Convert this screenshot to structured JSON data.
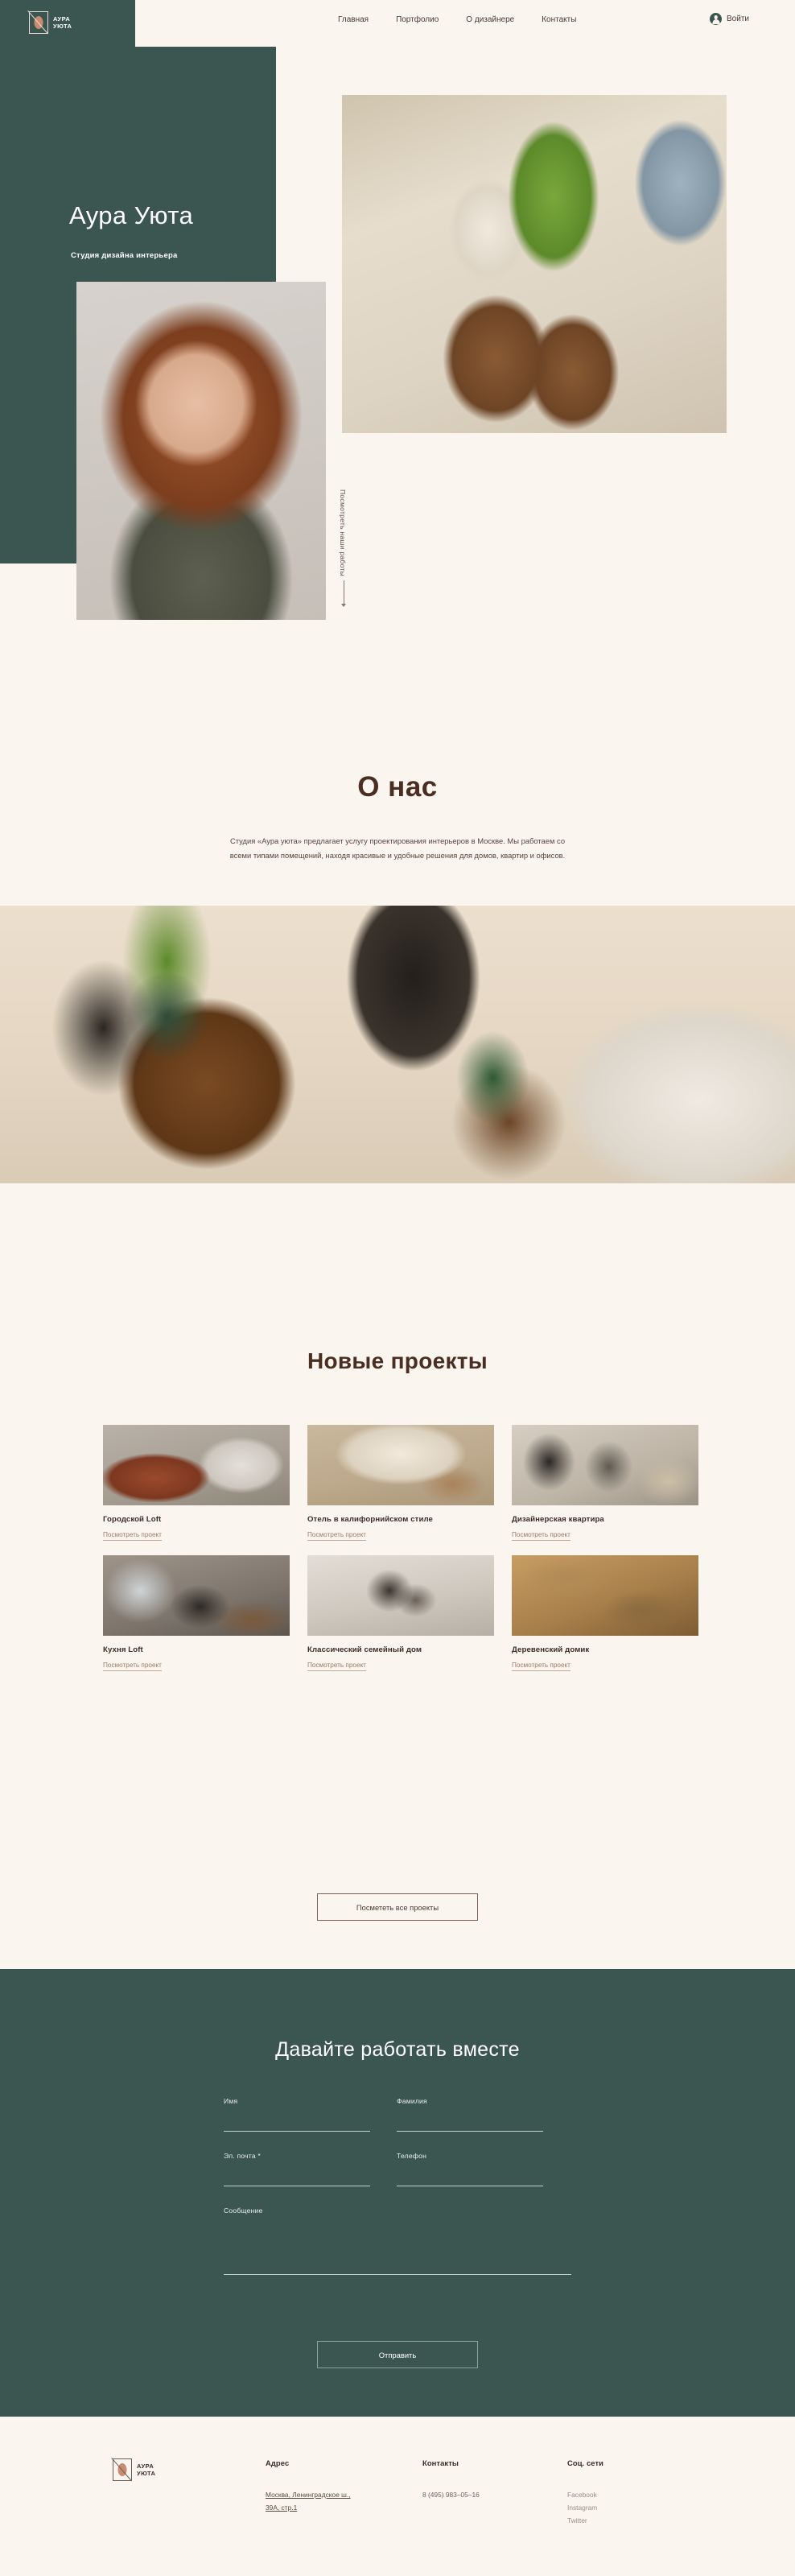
{
  "brand": {
    "line1": "АУРА",
    "line2": "УЮТА"
  },
  "header": {
    "nav": [
      {
        "label": "Главная"
      },
      {
        "label": "Портфолио"
      },
      {
        "label": "О дизайнере"
      },
      {
        "label": "Контакты"
      }
    ],
    "login_label": "Войти",
    "avatar_icon": "user-circle-icon"
  },
  "hero": {
    "title": "Аура Уюта",
    "subtitle": "Студия дизайна интерьера",
    "vertical_cta": "Посмотреть наши работы",
    "portrait_alt": "designer-portrait",
    "main_image_alt": "living-room-interior"
  },
  "about": {
    "heading": "О нас",
    "paragraph": "Студия «Аура уюта» предлагает услугу проектирования интерьеров в Москве. Мы работаем со всеми типами помещений, находя красивые и удобные решения для домов, квартир и офисов."
  },
  "band": {
    "alt": "interior-dresser-band-image"
  },
  "projects": {
    "heading": "Новые проекты",
    "link_label": "Посмотреть проект",
    "items": [
      {
        "title": "Городской Loft",
        "link": "Посмотреть проект"
      },
      {
        "title": "Отель в калифорнийском стиле",
        "link": "Посмотреть проект"
      },
      {
        "title": "Дизайнерская квартира",
        "link": "Посмотреть проект"
      },
      {
        "title": "Кухня Loft",
        "link": "Посмотреть проект"
      },
      {
        "title": "Классический семейный дом",
        "link": "Посмотреть проект"
      },
      {
        "title": "Деревенский домик",
        "link": "Посмотреть проект"
      }
    ],
    "all_button": "Посмететь все проекты"
  },
  "contact": {
    "heading": "Давайте работать вместе",
    "fields": {
      "first_name": "Имя",
      "last_name": "Фамилия",
      "email": "Эл. почта *",
      "phone": "Телефон",
      "message": "Сообщение"
    },
    "submit": "Отправить"
  },
  "footer": {
    "address": {
      "heading": "Адрес",
      "line1": "Москва, Ленинградское ш.,",
      "line2": "39А, стр.1"
    },
    "contacts": {
      "heading": "Контакты",
      "phone": "8 (495) 983–05–16"
    },
    "social": {
      "heading": "Соц. сети",
      "items": [
        "Facebook",
        "Instagram",
        "Twitter"
      ]
    }
  },
  "colors": {
    "green": "#3b5550",
    "cream": "#fbf5f0",
    "brown": "#4a2e22",
    "link": "#9d7a66"
  }
}
